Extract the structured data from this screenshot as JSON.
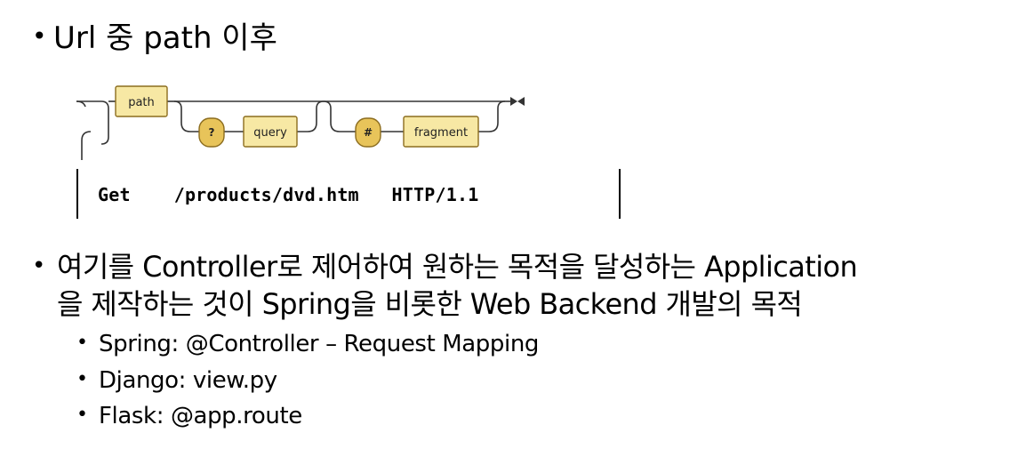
{
  "bullet1": {
    "bullet": "•",
    "text": "Url 중 path 이후"
  },
  "railroad": {
    "nodes": {
      "path": "path",
      "question": "?",
      "query": "query",
      "hash": "#",
      "fragment": "fragment"
    },
    "colors": {
      "box_fill": "#f7e8a4",
      "box_stroke": "#8c6d1f",
      "symbol_fill": "#e8c45a",
      "line": "#333333"
    }
  },
  "http_request": {
    "method": "Get",
    "path": "/products/dvd.htm",
    "version": "HTTP/1.1"
  },
  "bullet2": {
    "bullet": "•",
    "line1": "여기를 Controller로 제어하여 원하는 목적을 달성하는 Application",
    "line2": "을 제작하는 것이 Spring을 비롯한 Web Backend 개발의 목적"
  },
  "sub_bullets": [
    {
      "bullet": "•",
      "text": "Spring: @Controller – Request Mapping"
    },
    {
      "bullet": "•",
      "text": "Django: view.py"
    },
    {
      "bullet": "•",
      "text": "Flask: @app.route"
    }
  ]
}
